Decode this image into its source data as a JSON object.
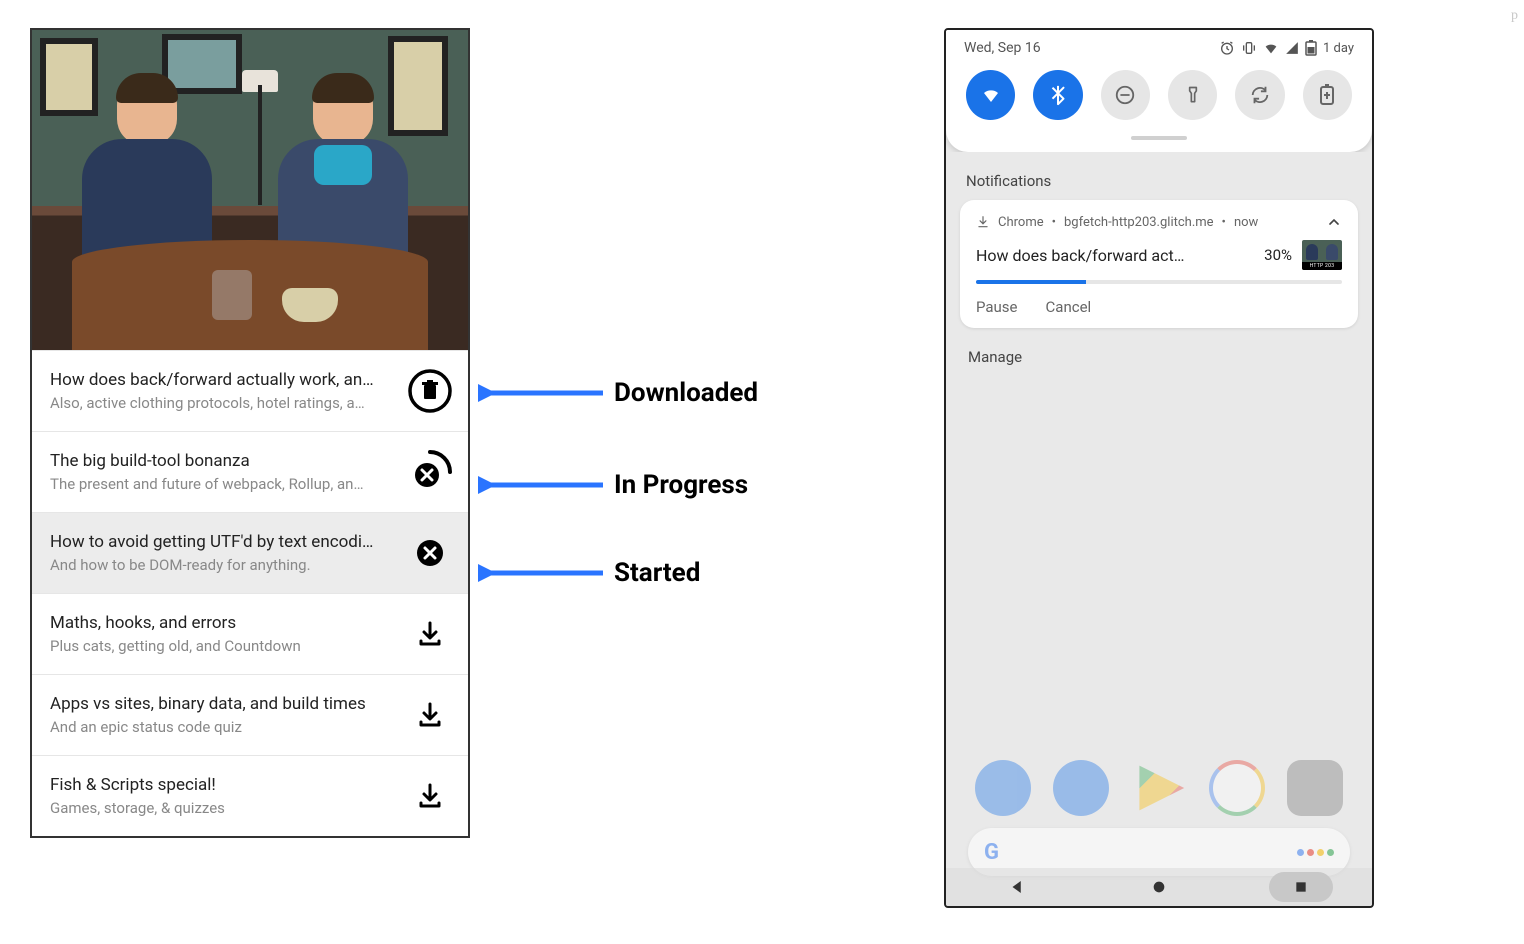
{
  "annotations": {
    "downloaded": "Downloaded",
    "in_progress": "In Progress",
    "started": "Started"
  },
  "episodes": [
    {
      "title": "How does back/forward actually work, an…",
      "subtitle": "Also, active clothing protocols, hotel ratings, a…",
      "status": "downloaded"
    },
    {
      "title": "The big build-tool bonanza",
      "subtitle": "The present and future of webpack, Rollup, an…",
      "status": "in_progress"
    },
    {
      "title": "How to avoid getting UTF'd by text encodi…",
      "subtitle": "And how to be DOM-ready for anything.",
      "status": "started"
    },
    {
      "title": "Maths, hooks, and errors",
      "subtitle": "Plus cats, getting old, and Countdown",
      "status": "none"
    },
    {
      "title": "Apps vs sites, binary data, and build times",
      "subtitle": "And an epic status code quiz",
      "status": "none"
    },
    {
      "title": "Fish & Scripts special!",
      "subtitle": "Games, storage, & quizzes",
      "status": "none"
    }
  ],
  "phone": {
    "status_date": "Wed, Sep 16",
    "battery_text": "1 day",
    "notifications_label": "Notifications",
    "manage_label": "Manage",
    "notification": {
      "app": "Chrome",
      "source": "bgfetch-http203.glitch.me",
      "time": "now",
      "title": "How does back/forward act…",
      "percent_text": "30%",
      "percent_value": 30,
      "thumb_tag": "HTTP 203",
      "actions": {
        "pause": "Pause",
        "cancel": "Cancel"
      }
    }
  },
  "colors": {
    "accent_blue": "#1a73e8",
    "arrow_blue": "#2a74ff"
  }
}
